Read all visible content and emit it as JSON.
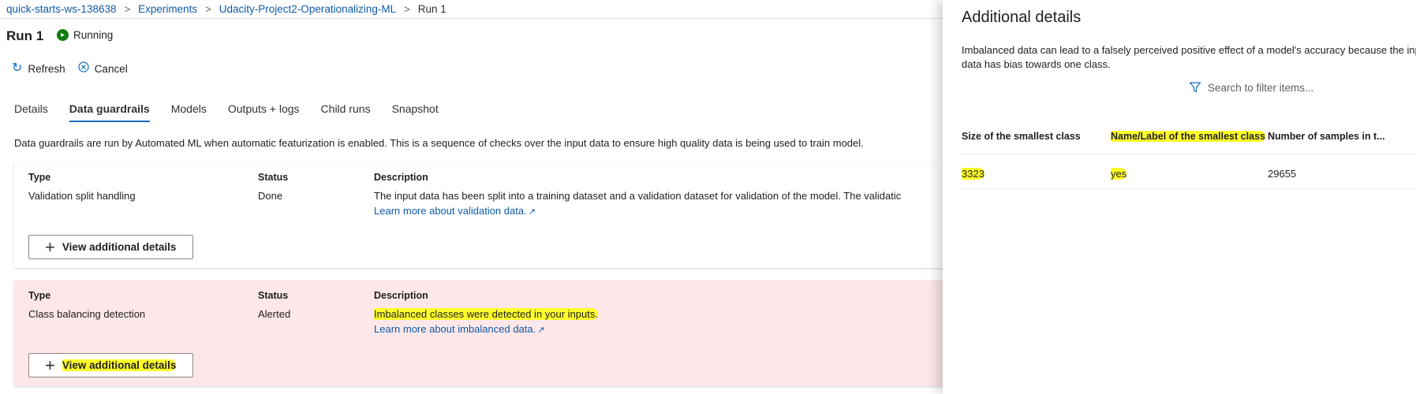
{
  "breadcrumb": {
    "items": [
      "quick-starts-ws-138638",
      "Experiments",
      "Udacity-Project2-Operationalizing-ML"
    ],
    "current": "Run 1",
    "separator": ">"
  },
  "run": {
    "title": "Run 1",
    "status": "Running"
  },
  "commands": {
    "refresh": "Refresh",
    "cancel": "Cancel"
  },
  "tabs": [
    {
      "label": "Details"
    },
    {
      "label": "Data guardrails"
    },
    {
      "label": "Models"
    },
    {
      "label": "Outputs + logs"
    },
    {
      "label": "Child runs"
    },
    {
      "label": "Snapshot"
    }
  ],
  "active_tab": "Data guardrails",
  "intro_text": "Data guardrails are run by Automated ML when automatic featurization is enabled. This is a sequence of checks over the input data to ensure high quality data is being used to train model.",
  "columns": {
    "type": "Type",
    "status": "Status",
    "description": "Description"
  },
  "guardrails": [
    {
      "type": "Validation split handling",
      "status": "Done",
      "description": "The input data has been split into a training dataset and a validation dataset for validation of the model. The validatic",
      "learn_more": "Learn more about validation data.",
      "button": "View additional details"
    },
    {
      "type": "Class balancing detection",
      "status": "Alerted",
      "description": "Imbalanced classes were detected in your inputs.",
      "learn_more": "Learn more about imbalanced data.",
      "button": "View additional details"
    }
  ],
  "panel": {
    "title": "Additional details",
    "description": "Imbalanced data can lead to a falsely perceived positive effect of a model's accuracy because the input data has bias towards one class.",
    "filter_placeholder": "Search to filter items...",
    "headers": [
      "Size of the smallest class",
      "Name/Label of the smallest class",
      "Number of samples in t..."
    ],
    "rows": [
      [
        "3323",
        "yes",
        "29655"
      ]
    ]
  },
  "colors": {
    "link": "#0f5ba8",
    "accent": "#0f6cbd",
    "running_green": "#107c10",
    "alert_bg": "#fde7e9",
    "highlight": "#ffff2a"
  }
}
